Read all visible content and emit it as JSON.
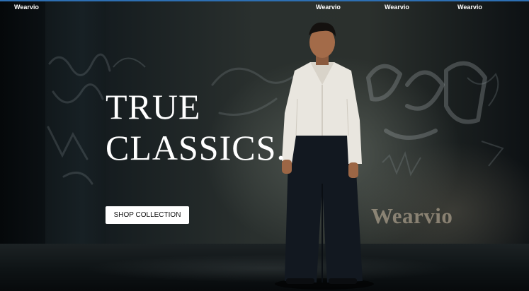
{
  "nav": {
    "brand": "Wearvio",
    "links": [
      "Wearvio",
      "Wearvio",
      "Wearvio"
    ]
  },
  "hero": {
    "headline_line1": "TRUE",
    "headline_line2": "CLASSICS.",
    "cta_label": "SHOP COLLECTION",
    "wall_logo": "Wearvio"
  },
  "colors": {
    "accent_topline": "#2d6fb3",
    "cta_background": "#ffffff",
    "headline_text": "#ffffff"
  }
}
